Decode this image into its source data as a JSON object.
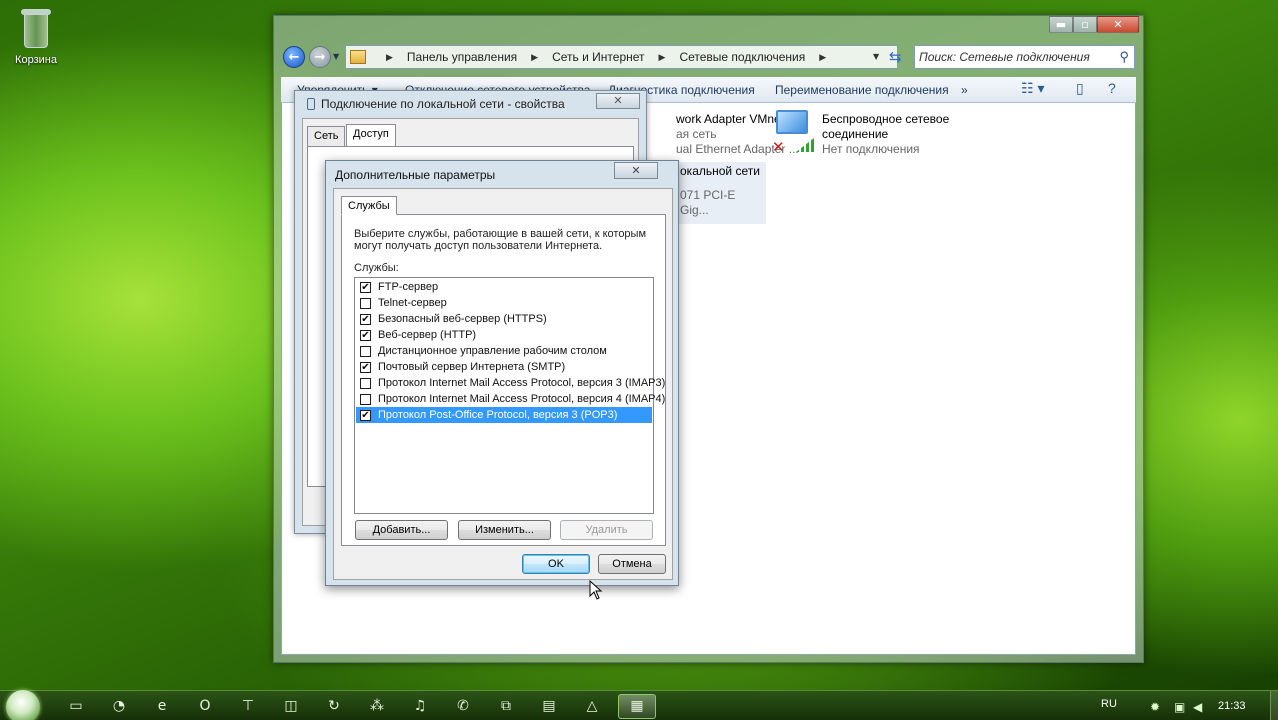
{
  "desktop": {
    "recycle_bin_label": "Корзина"
  },
  "explorer": {
    "breadcrumb": [
      "Панель управления",
      "Сеть и Интернет",
      "Сетевые подключения"
    ],
    "search_placeholder": "Поиск: Сетевые подключения",
    "toolbar": {
      "organize": "Упорядочить",
      "disable_device": "Отключение сетевого устройства",
      "diagnose": "Диагностика подключения",
      "rename": "Переименование подключения",
      "more": "»"
    },
    "connections": [
      {
        "name": "work Adapter VMnet8",
        "line2": "ая сеть",
        "line3": "ual Ethernet Adapter ..."
      },
      {
        "name": "Беспроводное сетевое",
        "name2": "соединение",
        "status": "Нет подключения"
      },
      {
        "name": "окальной сети",
        "line2": "071 PCI-E Gig..."
      }
    ]
  },
  "properties_dialog": {
    "title": "Подключение по локальной сети - свойства",
    "tabs": [
      "Сеть",
      "Доступ"
    ],
    "close": "✕"
  },
  "advanced_dialog": {
    "title": "Дополнительные параметры",
    "close": "✕",
    "tab": "Службы",
    "description": "Выберите службы, работающие в вашей сети, к которым могут получать доступ пользователи Интернета.",
    "services_label": "Службы:",
    "services": [
      {
        "label": "FTP-сервер",
        "checked": true
      },
      {
        "label": "Telnet-сервер",
        "checked": false
      },
      {
        "label": "Безопасный веб-сервер (HTTPS)",
        "checked": true
      },
      {
        "label": "Веб-сервер (HTTP)",
        "checked": true
      },
      {
        "label": "Дистанционное управление рабочим столом",
        "checked": false
      },
      {
        "label": "Почтовый сервер Интернета (SMTP)",
        "checked": true
      },
      {
        "label": "Протокол Internet Mail Access Protocol, версия 3 (IMAP3)",
        "checked": false
      },
      {
        "label": "Протокол Internet Mail Access Protocol, версия 4 (IMAP4)",
        "checked": false
      },
      {
        "label": "Протокол Post-Office Protocol, версия 3 (POP3)",
        "checked": true,
        "selected": true
      }
    ],
    "buttons": {
      "add": "Добавить...",
      "edit": "Изменить...",
      "delete": "Удалить",
      "ok": "OK",
      "cancel": "Отмена"
    }
  },
  "taskbar": {
    "language": "RU",
    "clock": "21:33"
  }
}
